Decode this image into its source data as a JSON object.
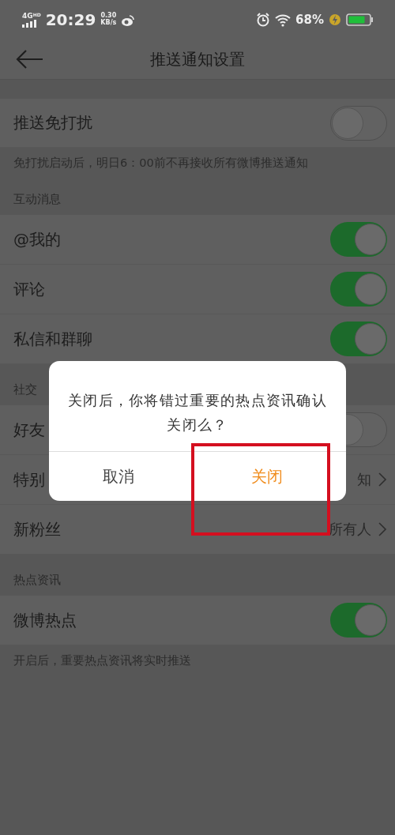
{
  "status_bar": {
    "network": "4G",
    "network_badge": "HD",
    "time": "20:29",
    "speed": "0.30",
    "speed_unit": "KB/s",
    "battery": "68%",
    "charging": true
  },
  "header": {
    "title": "推送通知设置"
  },
  "sections": [
    {
      "items": [
        {
          "kind": "toggle",
          "label": "推送免打扰",
          "on": false
        }
      ],
      "footnote": "免打扰启动后，明日6：00前不再接收所有微博推送通知"
    },
    {
      "title": "互动消息",
      "items": [
        {
          "kind": "toggle",
          "label": "@我的",
          "on": true
        },
        {
          "kind": "toggle",
          "label": "评论",
          "on": true
        },
        {
          "kind": "toggle",
          "label": "私信和群聊",
          "on": true
        }
      ]
    },
    {
      "title": "社交",
      "items": [
        {
          "kind": "toggle",
          "label": "好友",
          "on": false
        },
        {
          "kind": "link",
          "label": "特别",
          "value": "知"
        },
        {
          "kind": "link",
          "label": "新粉丝",
          "value": "所有人"
        }
      ]
    },
    {
      "title": "热点资讯",
      "items": [
        {
          "kind": "toggle",
          "label": "微博热点",
          "on": true
        }
      ],
      "footnote": "开启后，重要热点资讯将实时推送"
    }
  ],
  "dialog": {
    "message": "关闭后，你将错过重要的热点资讯确认关闭么？",
    "buttons": [
      {
        "kind": "cancel",
        "label": "取消",
        "highlighted": false
      },
      {
        "kind": "confirm",
        "label": "关闭",
        "highlighted": true
      }
    ]
  }
}
